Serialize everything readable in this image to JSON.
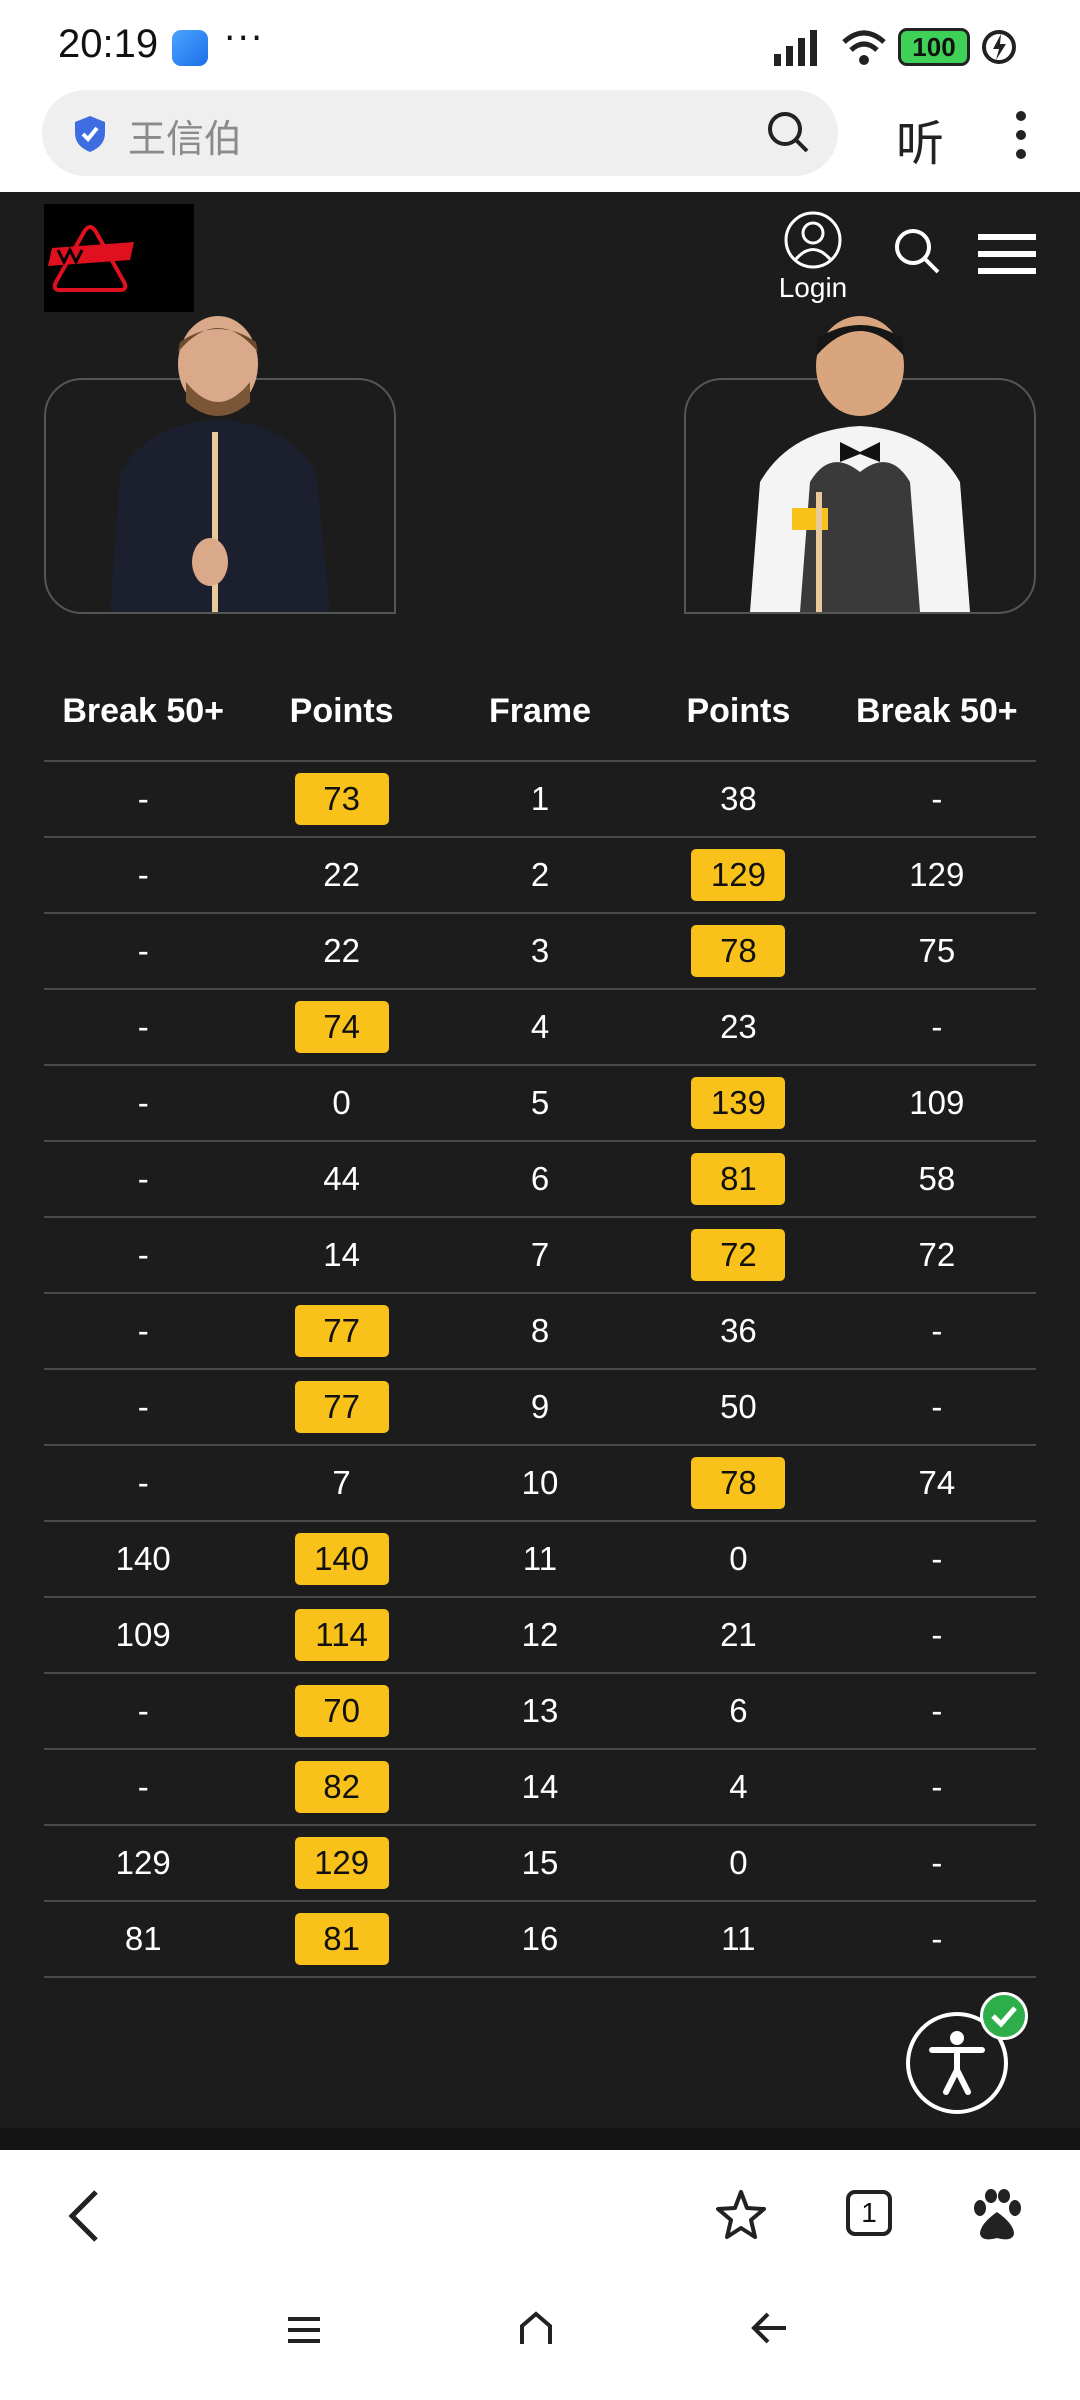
{
  "status_bar": {
    "time": "20:19",
    "overflow": "···",
    "battery": "100",
    "icons": [
      "app-notification-icon",
      "signal-icon",
      "wifi-icon",
      "battery-icon",
      "charging-icon"
    ]
  },
  "browser": {
    "url_text": "王信伯",
    "listen_label": "听",
    "icons": [
      "shield-icon",
      "search-icon",
      "more-icon"
    ]
  },
  "site_header": {
    "login_label": "Login",
    "icons": [
      "logo",
      "user-icon",
      "search-icon",
      "menu-icon"
    ]
  },
  "colors": {
    "background": "#1c1c1c",
    "highlight": "#f9c21b",
    "row_divider": "#4a4a4a"
  },
  "table": {
    "headers": [
      "Break 50+",
      "Points",
      "Frame",
      "Points",
      "Break 50+"
    ],
    "rows": [
      {
        "l_break": "-",
        "l_points": "73",
        "frame": "1",
        "r_points": "38",
        "r_break": "-"
      },
      {
        "l_break": "-",
        "l_points": "22",
        "frame": "2",
        "r_points": "129",
        "r_break": "129"
      },
      {
        "l_break": "-",
        "l_points": "22",
        "frame": "3",
        "r_points": "78",
        "r_break": "75"
      },
      {
        "l_break": "-",
        "l_points": "74",
        "frame": "4",
        "r_points": "23",
        "r_break": "-"
      },
      {
        "l_break": "-",
        "l_points": "0",
        "frame": "5",
        "r_points": "139",
        "r_break": "109"
      },
      {
        "l_break": "-",
        "l_points": "44",
        "frame": "6",
        "r_points": "81",
        "r_break": "58"
      },
      {
        "l_break": "-",
        "l_points": "14",
        "frame": "7",
        "r_points": "72",
        "r_break": "72"
      },
      {
        "l_break": "-",
        "l_points": "77",
        "frame": "8",
        "r_points": "36",
        "r_break": "-"
      },
      {
        "l_break": "-",
        "l_points": "77",
        "frame": "9",
        "r_points": "50",
        "r_break": "-"
      },
      {
        "l_break": "-",
        "l_points": "7",
        "frame": "10",
        "r_points": "78",
        "r_break": "74"
      },
      {
        "l_break": "140",
        "l_points": "140",
        "frame": "11",
        "r_points": "0",
        "r_break": "-"
      },
      {
        "l_break": "109",
        "l_points": "114",
        "frame": "12",
        "r_points": "21",
        "r_break": "-"
      },
      {
        "l_break": "-",
        "l_points": "70",
        "frame": "13",
        "r_points": "6",
        "r_break": "-"
      },
      {
        "l_break": "-",
        "l_points": "82",
        "frame": "14",
        "r_points": "4",
        "r_break": "-"
      },
      {
        "l_break": "129",
        "l_points": "129",
        "frame": "15",
        "r_points": "0",
        "r_break": "-"
      },
      {
        "l_break": "81",
        "l_points": "81",
        "frame": "16",
        "r_points": "11",
        "r_break": "-"
      }
    ]
  },
  "bottom_bar": {
    "tab_count": "1",
    "icons": [
      "back-icon",
      "star-icon",
      "tabs-icon",
      "baidu-icon"
    ]
  },
  "nav_bar": {
    "icons": [
      "menu-icon",
      "home-icon",
      "back-icon"
    ]
  }
}
